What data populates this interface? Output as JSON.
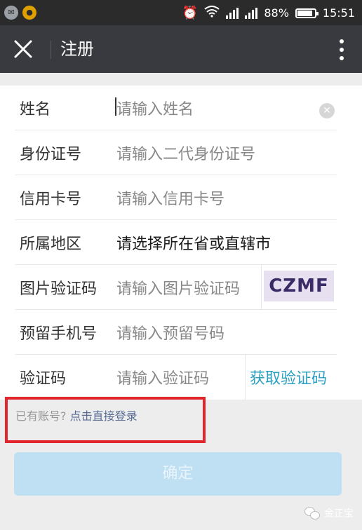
{
  "status_bar": {
    "battery": "88%",
    "battery_level": 0.88,
    "time": "15:51",
    "app_icons": [
      "message-app-icon",
      "notification-app-icon"
    ],
    "status_icons": [
      "alarm-icon",
      "wifi-icon",
      "signal-icon",
      "signal-icon",
      "battery-icon"
    ]
  },
  "header": {
    "title": "注册",
    "close_icon": "close-icon",
    "more_icon": "more-vertical-icon",
    "background": "#393a3f"
  },
  "form": {
    "rows": [
      {
        "label": "姓名",
        "placeholder": "请输入姓名"
      },
      {
        "label": "身份证号",
        "placeholder": "请输入二代身份证号"
      },
      {
        "label": "信用卡号",
        "placeholder": "请输入信用卡号"
      },
      {
        "label": "所属地区",
        "placeholder": "请选择所在省或直辖市"
      },
      {
        "label": "图片验证码",
        "placeholder": "请输入图片验证码",
        "captcha": "CZMF"
      },
      {
        "label": "预留手机号",
        "placeholder": "请输入预留号码"
      },
      {
        "label": "验证码",
        "placeholder": "请输入验证码",
        "action": "获取验证码"
      }
    ]
  },
  "login": {
    "prefix": "已有账号?",
    "link": "点击直接登录"
  },
  "confirm_label": "确定",
  "watermark": "金正宝",
  "colors": {
    "accent_link": "#2aa0c2",
    "button_disabled": "#bfdff3",
    "highlight": "#e2262e"
  }
}
